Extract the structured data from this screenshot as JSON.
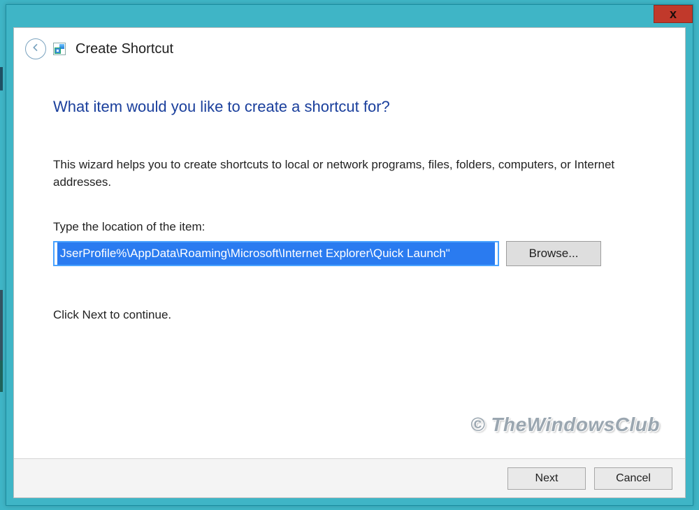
{
  "header": {
    "title": "Create Shortcut"
  },
  "close": {
    "glyph": "x"
  },
  "main": {
    "heading": "What item would you like to create a shortcut for?",
    "description": "This wizard helps you to create shortcuts to local or network programs, files, folders, computers, or Internet addresses.",
    "location_label": "Type the location of the item:",
    "path_value": "JserProfile%\\AppData\\Roaming\\Microsoft\\Internet Explorer\\Quick Launch\"",
    "browse_label": "Browse...",
    "continue_text": "Click Next to continue."
  },
  "footer": {
    "next": "Next",
    "cancel": "Cancel"
  },
  "watermark": "© TheWindowsClub"
}
